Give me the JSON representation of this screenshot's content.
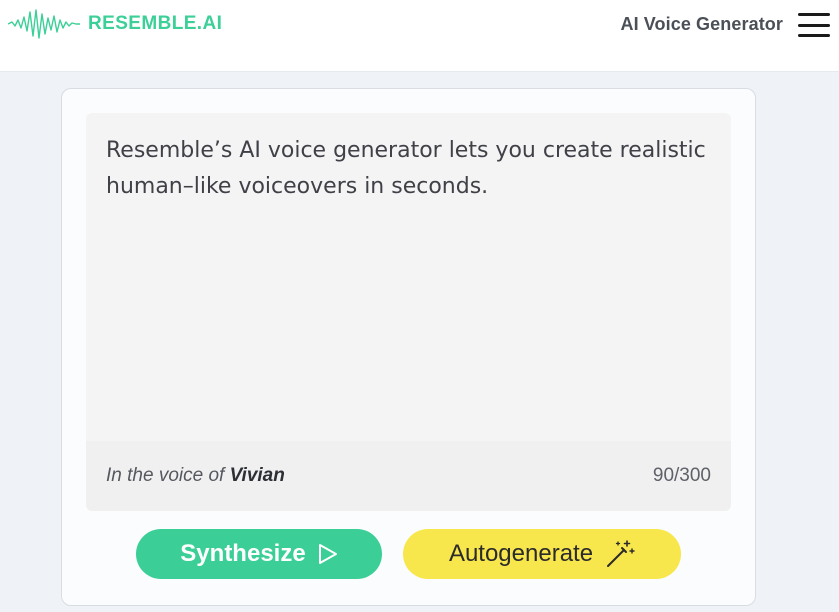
{
  "header": {
    "logo_text": "RESEMBLE.AI",
    "nav_title": "AI Voice Generator"
  },
  "editor": {
    "text": "Resemble’s AI voice generator lets you create realistic human–like voiceovers in seconds.",
    "voice_prefix": "In the voice of",
    "voice_name": "Vivian",
    "char_count": "90/300"
  },
  "actions": {
    "synthesize_label": "Synthesize",
    "autogenerate_label": "Autogenerate"
  },
  "icons": {
    "logo": "waveform-icon",
    "menu": "hamburger-menu-icon",
    "synthesize": "play-icon",
    "autogenerate": "magic-wand-icon"
  },
  "colors": {
    "brand_green": "#3bcf97",
    "accent_yellow": "#f8e74c",
    "page_background": "#eff2f6"
  }
}
